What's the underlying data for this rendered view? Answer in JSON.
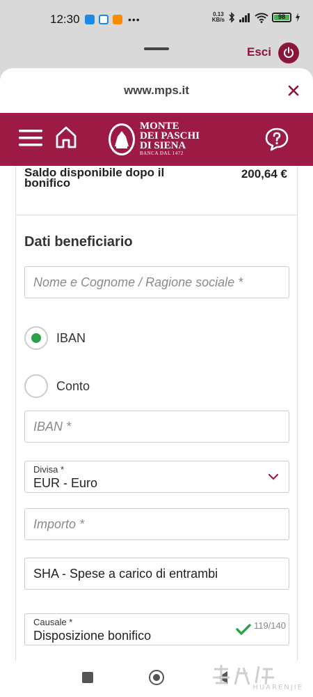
{
  "status_bar": {
    "time": "12:30",
    "more": "•••",
    "net_speed_value": "0.13",
    "net_speed_unit": "KB/s",
    "battery_level": "98",
    "battery_fraction": 0.98,
    "app_icon_colors": [
      "#1e88e5",
      "#1e88e5",
      "#fb8c00"
    ]
  },
  "top_bar": {
    "exit_label": "Esci"
  },
  "browser": {
    "url": "www.mps.it"
  },
  "bank_header": {
    "background_color": "#9b1b44",
    "logo_line1": "MONTE",
    "logo_line2": "DEI PASCHI",
    "logo_line3": "DI SIENA",
    "logo_sub": "BANCA DAL 1472"
  },
  "summary": {
    "balance_label": "Saldo disponibile dopo il bonifico",
    "balance_value": "200,64 €"
  },
  "beneficiary": {
    "section_title": "Dati beneficiario",
    "name_placeholder": "Nome e Cognome / Ragione sociale *",
    "account_type_options": [
      {
        "label": "IBAN",
        "selected": true
      },
      {
        "label": "Conto",
        "selected": false
      }
    ],
    "iban_placeholder": "IBAN *",
    "currency_label": "Divisa *",
    "currency_value": "EUR - Euro",
    "amount_placeholder": "Importo *",
    "charges_value": "SHA - Spese a carico di entrambi",
    "reason_label": "Causale *",
    "reason_value": "Disposizione bonifico",
    "reason_counter": "119/140"
  },
  "watermark": {
    "text": "HUARENJIE"
  },
  "colors": {
    "accent": "#8a1538",
    "radio_selected": "#2ba14a",
    "valid_check": "#2ba14a"
  }
}
